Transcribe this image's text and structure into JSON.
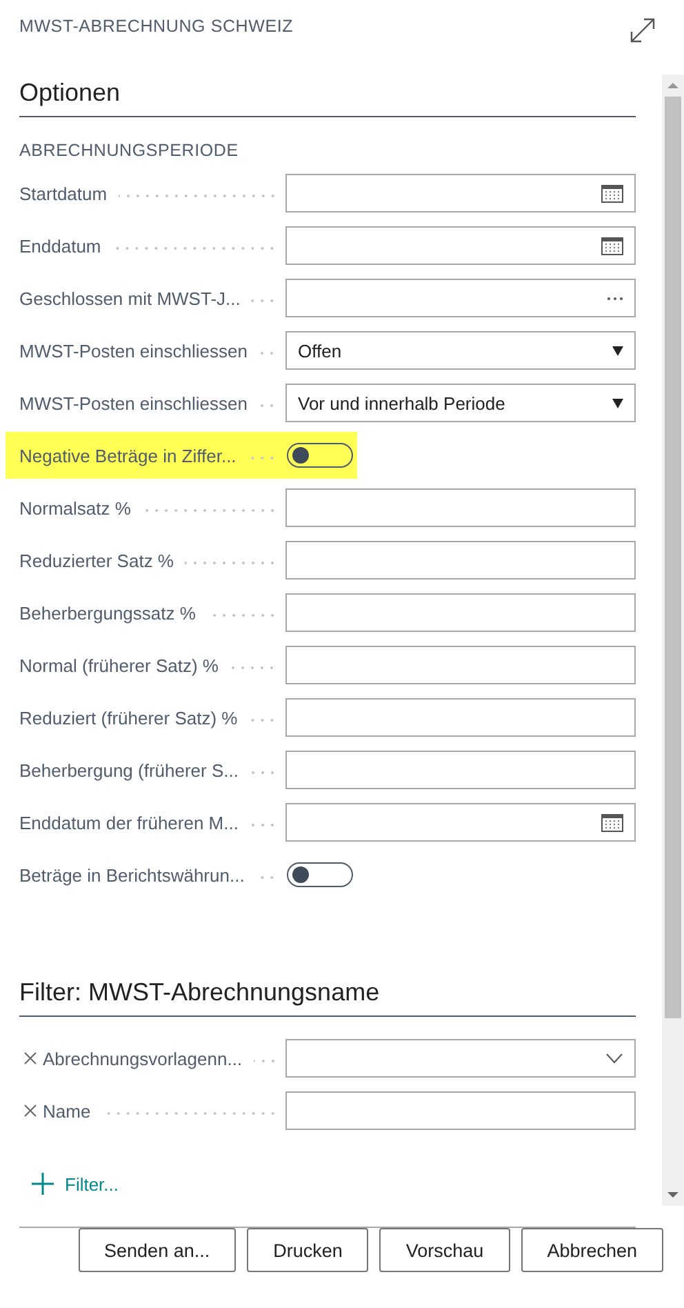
{
  "window": {
    "title": "MWST-ABRECHNUNG SCHWEIZ"
  },
  "options": {
    "title": "Optionen",
    "group": "ABRECHNUNGSPERIODE",
    "fields": [
      {
        "label": "Startdatum",
        "kind": "date",
        "highlighted": false
      },
      {
        "label": "Enddatum",
        "kind": "date",
        "highlighted": false
      },
      {
        "label": "Geschlossen mit MWST-J...",
        "kind": "lookup",
        "highlighted": false
      },
      {
        "label": "MWST-Posten einschliessen",
        "kind": "select",
        "value": "Offen",
        "highlighted": false
      },
      {
        "label": "MWST-Posten einschliessen",
        "kind": "select",
        "value": "Vor und innerhalb Periode",
        "highlighted": false
      },
      {
        "label": "Negative Beträge in Ziffer...",
        "kind": "toggle",
        "on": false,
        "highlighted": true
      },
      {
        "label": "Normalsatz %",
        "kind": "text",
        "highlighted": false
      },
      {
        "label": "Reduzierter Satz %",
        "kind": "text",
        "highlighted": false
      },
      {
        "label": "Beherbergungssatz %",
        "kind": "text",
        "highlighted": false
      },
      {
        "label": "Normal (früherer Satz) %",
        "kind": "text",
        "highlighted": false
      },
      {
        "label": "Reduziert (früherer Satz) %",
        "kind": "text",
        "highlighted": false
      },
      {
        "label": "Beherbergung (früherer S...",
        "kind": "text",
        "highlighted": false
      },
      {
        "label": "Enddatum der früheren M...",
        "kind": "date",
        "highlighted": false
      },
      {
        "label": "Beträge in Berichtswährun...",
        "kind": "toggle",
        "on": false,
        "highlighted": false
      }
    ]
  },
  "filter": {
    "title": "Filter: MWST-Abrechnungsname",
    "fields": [
      {
        "label": "Abrechnungsvorlagenn...",
        "kind": "combo"
      },
      {
        "label": "Name",
        "kind": "text"
      }
    ],
    "add_filter": "Filter..."
  },
  "buttons": [
    "Senden an...",
    "Drucken",
    "Vorschau",
    "Abbrechen"
  ]
}
